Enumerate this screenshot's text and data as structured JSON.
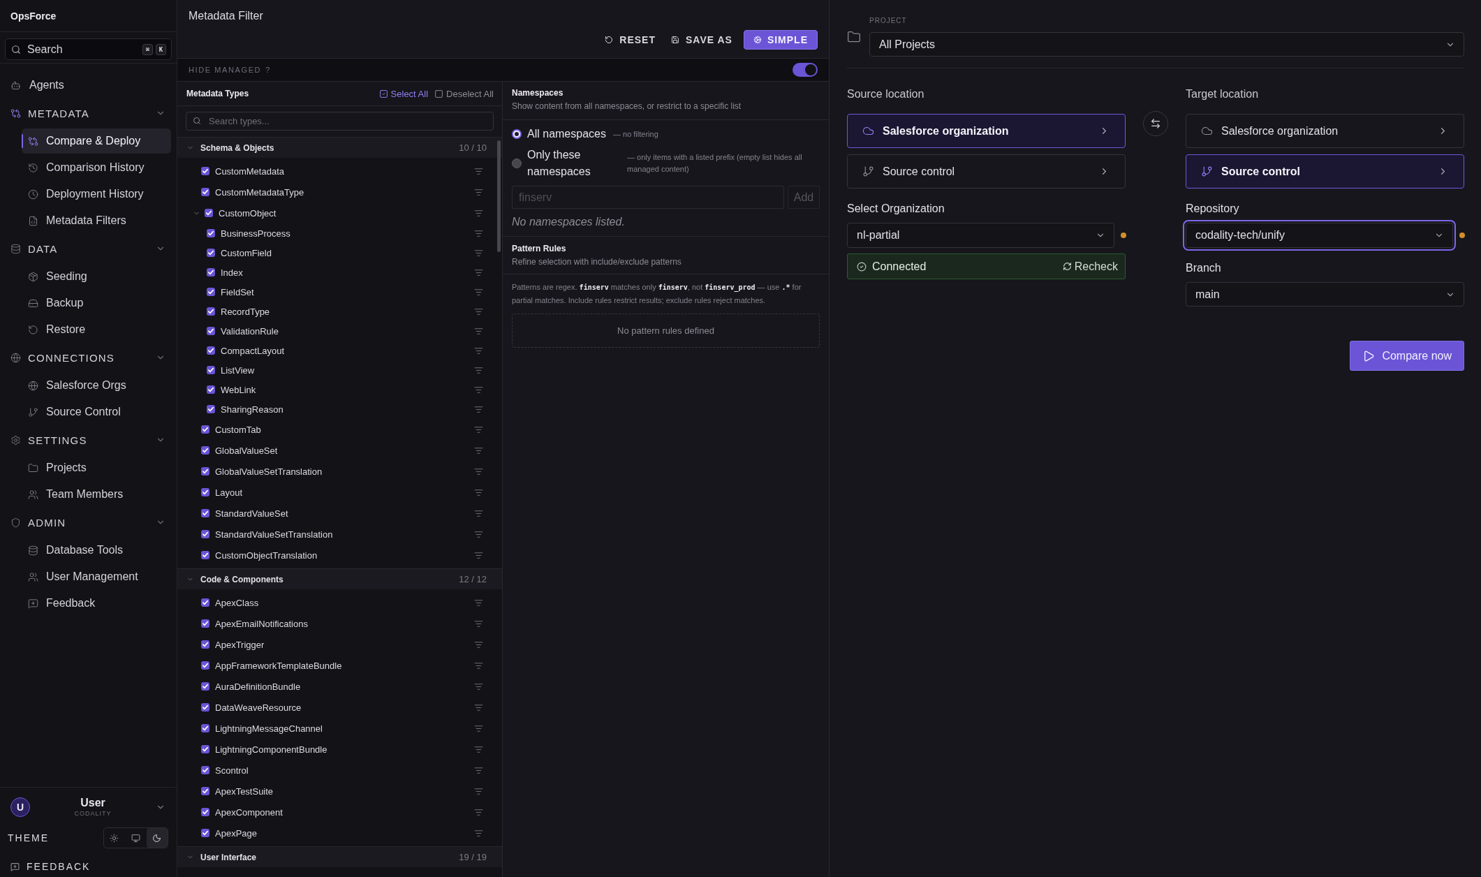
{
  "sidebar": {
    "brand": "OpsForce",
    "search": {
      "label": "Search",
      "keys": [
        "⌘",
        "K"
      ]
    },
    "nav": [
      {
        "kind": "link",
        "label": "Agents",
        "selected": false
      },
      {
        "kind": "section",
        "label": "METADATA",
        "expanded": true,
        "items": [
          {
            "label": "Compare & Deploy",
            "selected": true
          },
          {
            "label": "Comparison History",
            "selected": false
          },
          {
            "label": "Deployment History",
            "selected": false
          },
          {
            "label": "Metadata Filters",
            "selected": false
          }
        ]
      },
      {
        "kind": "section",
        "label": "DATA",
        "expanded": true,
        "items": [
          {
            "label": "Seeding",
            "selected": false
          },
          {
            "label": "Backup",
            "selected": false
          },
          {
            "label": "Restore",
            "selected": false
          }
        ]
      },
      {
        "kind": "section",
        "label": "CONNECTIONS",
        "expanded": true,
        "items": [
          {
            "label": "Salesforce Orgs",
            "selected": false
          },
          {
            "label": "Source Control",
            "selected": false
          }
        ]
      },
      {
        "kind": "section",
        "label": "SETTINGS",
        "expanded": true,
        "items": [
          {
            "label": "Projects",
            "selected": false
          },
          {
            "label": "Team Members",
            "selected": false
          }
        ]
      },
      {
        "kind": "section",
        "label": "ADMIN",
        "expanded": true,
        "items": [
          {
            "label": "Database Tools",
            "selected": false
          },
          {
            "label": "User Management",
            "selected": false
          },
          {
            "label": "Feedback",
            "selected": false
          }
        ]
      }
    ],
    "user": {
      "initial": "U",
      "name": "User",
      "org": "CODALITY"
    },
    "theme": {
      "label": "THEME",
      "options": [
        {
          "selected": false
        },
        {
          "selected": false
        },
        {
          "selected": true
        }
      ]
    },
    "feedback": {
      "label": "FEEDBACK"
    }
  },
  "filter_editor": {
    "title": "Metadata Filter",
    "actions": [
      {
        "kind": "text",
        "label": "RESET"
      },
      {
        "kind": "text",
        "label": "SAVE AS"
      },
      {
        "kind": "primary",
        "label": "SIMPLE"
      }
    ],
    "hide_managed": {
      "label": "HIDE MANAGED",
      "help": "?",
      "on": true
    },
    "metadata_types": {
      "title": "Metadata Types",
      "bulk_actions": [
        {
          "label": "Select All",
          "active": true
        },
        {
          "label": "Deselect All",
          "active": false
        }
      ],
      "search": {
        "placeholder": "Search types..."
      },
      "groups": [
        {
          "name": "Schema & Objects",
          "count": "10 / 10",
          "expanded": true,
          "items": [
            {
              "name": "CustomMetadata",
              "checked": true
            },
            {
              "name": "CustomMetadataType",
              "checked": true
            },
            {
              "name": "CustomObject",
              "checked": true,
              "expanded": true,
              "children": [
                {
                  "name": "BusinessProcess",
                  "checked": true
                },
                {
                  "name": "CustomField",
                  "checked": true
                },
                {
                  "name": "Index",
                  "checked": true
                },
                {
                  "name": "FieldSet",
                  "checked": true
                },
                {
                  "name": "RecordType",
                  "checked": true
                },
                {
                  "name": "ValidationRule",
                  "checked": true
                },
                {
                  "name": "CompactLayout",
                  "checked": true
                },
                {
                  "name": "ListView",
                  "checked": true
                },
                {
                  "name": "WebLink",
                  "checked": true
                },
                {
                  "name": "SharingReason",
                  "checked": true
                }
              ]
            },
            {
              "name": "CustomTab",
              "checked": true
            },
            {
              "name": "GlobalValueSet",
              "checked": true
            },
            {
              "name": "GlobalValueSetTranslation",
              "checked": true
            },
            {
              "name": "Layout",
              "checked": true
            },
            {
              "name": "StandardValueSet",
              "checked": true
            },
            {
              "name": "StandardValueSetTranslation",
              "checked": true
            },
            {
              "name": "CustomObjectTranslation",
              "checked": true
            }
          ]
        },
        {
          "name": "Code & Components",
          "count": "12 / 12",
          "expanded": true,
          "items": [
            {
              "name": "ApexClass",
              "checked": true
            },
            {
              "name": "ApexEmailNotifications",
              "checked": true
            },
            {
              "name": "ApexTrigger",
              "checked": true
            },
            {
              "name": "AppFrameworkTemplateBundle",
              "checked": true
            },
            {
              "name": "AuraDefinitionBundle",
              "checked": true
            },
            {
              "name": "DataWeaveResource",
              "checked": true
            },
            {
              "name": "LightningMessageChannel",
              "checked": true
            },
            {
              "name": "LightningComponentBundle",
              "checked": true
            },
            {
              "name": "Scontrol",
              "checked": true
            },
            {
              "name": "ApexTestSuite",
              "checked": true
            },
            {
              "name": "ApexComponent",
              "checked": true
            },
            {
              "name": "ApexPage",
              "checked": true
            }
          ]
        },
        {
          "name": "User Interface",
          "count": "19 / 19",
          "expanded": true
        }
      ]
    },
    "namespaces": {
      "title": "Namespaces",
      "subtitle": "Show content from all namespaces, or restrict to a specific list",
      "options": [
        {
          "label": "All namespaces",
          "hint": "— no filtering",
          "selected": true
        },
        {
          "label": "Only these namespaces",
          "hint": "— only items with a listed prefix (empty list hides all managed content)",
          "selected": false
        }
      ],
      "input": {
        "placeholder": "finserv"
      },
      "add_button": {
        "label": "Add",
        "disabled": true
      },
      "empty": "No namespaces listed."
    },
    "pattern_rules": {
      "title": "Pattern Rules",
      "subtitle": "Refine selection with include/exclude patterns",
      "help": [
        {
          "kind": "text",
          "text": "Patterns are regex. "
        },
        {
          "kind": "code",
          "text": "finserv"
        },
        {
          "kind": "text",
          "text": " matches only "
        },
        {
          "kind": "code",
          "text": "finserv"
        },
        {
          "kind": "text",
          "text": ", not "
        },
        {
          "kind": "code",
          "text": "finserv_prod"
        },
        {
          "kind": "text",
          "text": " — use "
        },
        {
          "kind": "code",
          "text": ".*"
        },
        {
          "kind": "text",
          "text": " for partial matches. Include rules restrict results; exclude rules reject matches."
        }
      ],
      "empty": "No pattern rules defined"
    }
  },
  "comparison": {
    "project": {
      "label": "PROJECT",
      "value": "All Projects"
    },
    "source": {
      "title": "Source location",
      "options": [
        {
          "label": "Salesforce organization",
          "selected": true
        },
        {
          "label": "Source control",
          "selected": false
        }
      ],
      "fields": [
        {
          "label": "Select Organization",
          "value": "nl-partial",
          "focused": false,
          "flagged": true
        }
      ],
      "status": {
        "label": "Connected",
        "action": "Recheck"
      }
    },
    "target": {
      "title": "Target location",
      "options": [
        {
          "label": "Salesforce organization",
          "selected": false
        },
        {
          "label": "Source control",
          "selected": true
        }
      ],
      "fields": [
        {
          "label": "Repository",
          "value": "codality-tech/unify",
          "focused": true,
          "flagged": true
        },
        {
          "label": "Branch",
          "value": "main",
          "focused": false,
          "flagged": false
        }
      ]
    },
    "compare_button": {
      "label": "Compare now"
    }
  }
}
